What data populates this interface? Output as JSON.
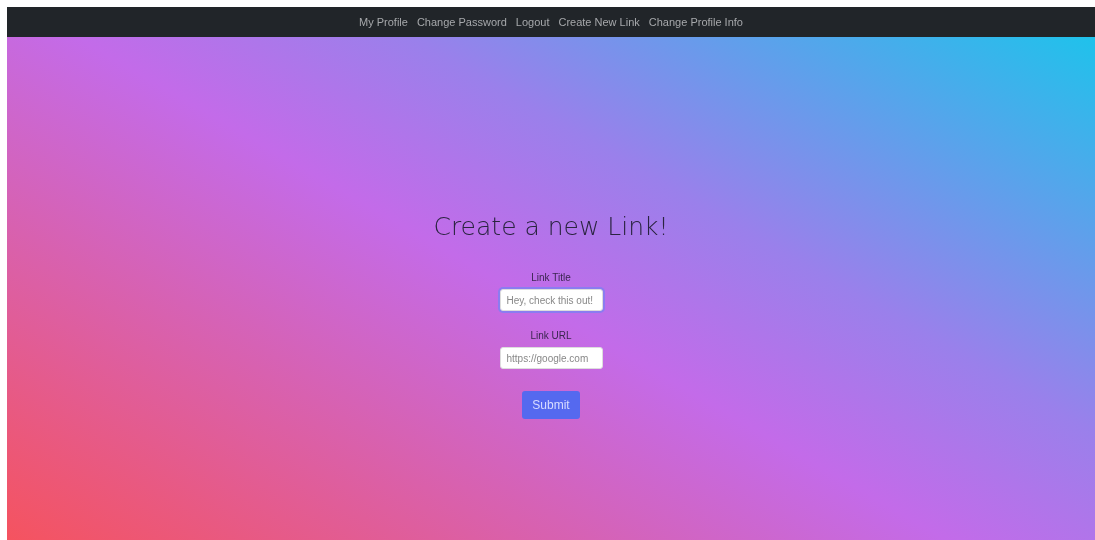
{
  "nav": {
    "links": [
      "My Profile",
      "Change Password",
      "Logout",
      "Create New Link",
      "Change Profile Info"
    ]
  },
  "form": {
    "heading": "Create a new Link!",
    "fields": [
      {
        "label": "Link Title",
        "placeholder": "Hey, check this out!",
        "focused": true
      },
      {
        "label": "Link URL",
        "placeholder": "https://google.com",
        "focused": false
      }
    ],
    "submit": "Submit"
  }
}
